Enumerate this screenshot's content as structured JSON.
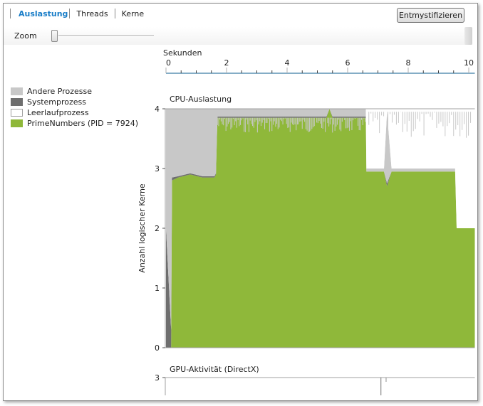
{
  "tabs": [
    {
      "label": "Auslastung",
      "active": true
    },
    {
      "label": "Threads",
      "active": false
    },
    {
      "label": "Kerne",
      "active": false
    }
  ],
  "toolbar": {
    "demystify_label": "Entmystifizieren",
    "zoom_label": "Zoom",
    "zoom_level": 0
  },
  "timeline": {
    "label": "Sekunden",
    "ticks": [
      "0",
      "2",
      "4",
      "6",
      "8",
      "10"
    ]
  },
  "legend": [
    {
      "label": "Andere Prozesse",
      "color": "#c8c8c8"
    },
    {
      "label": "Systemprozess",
      "color": "#6e6e6e"
    },
    {
      "label": "Leerlaufprozess",
      "color": "#ffffff"
    },
    {
      "label": "PrimeNumbers (PID = 7924)",
      "color": "#8fb83a"
    }
  ],
  "chart_data": [
    {
      "type": "area",
      "title": "CPU-Auslastung",
      "xlabel": "Sekunden",
      "ylabel": "Anzahl logischer Kerne",
      "xlim": [
        0,
        10.2
      ],
      "ylim": [
        0,
        4
      ],
      "yticks": [
        "0",
        "1",
        "2",
        "3",
        "4"
      ],
      "xticks": [
        0,
        2,
        4,
        6,
        8,
        10
      ],
      "x": [
        0,
        0.1,
        0.17,
        0.2,
        0.4,
        0.8,
        1.2,
        1.6,
        1.65,
        1.7,
        2.5,
        3.5,
        4.5,
        5.3,
        5.4,
        5.5,
        6.2,
        6.6,
        6.62,
        7.0,
        7.2,
        7.3,
        7.45,
        7.5,
        8.5,
        9.5,
        9.55,
        9.6,
        10.2
      ],
      "series": [
        {
          "name": "PrimeNumbers (PID = 7924)",
          "color": "#8fb83a",
          "values": [
            0,
            0,
            0,
            2.8,
            2.85,
            2.9,
            2.85,
            2.85,
            2.9,
            3.85,
            3.85,
            3.85,
            3.85,
            3.85,
            4.0,
            3.85,
            3.85,
            3.85,
            2.95,
            2.95,
            2.95,
            2.7,
            2.95,
            2.95,
            2.95,
            2.95,
            2.95,
            2.0,
            2.0
          ]
        },
        {
          "name": "Systemprozess",
          "color": "#6e6e6e",
          "values": [
            2.0,
            1.0,
            0.3,
            0.05,
            0.02,
            0.02,
            0.02,
            0.02,
            0.02,
            0.02,
            0.02,
            0.02,
            0.02,
            0.02,
            0,
            0.02,
            0.02,
            0.02,
            0,
            0,
            0,
            0.05,
            0,
            0,
            0,
            0,
            0,
            0,
            0
          ]
        },
        {
          "name": "Andere Prozesse",
          "color": "#c8c8c8",
          "values": [
            2.0,
            3.0,
            3.7,
            1.15,
            1.13,
            1.08,
            1.13,
            1.13,
            1.08,
            0.13,
            0.13,
            0.13,
            0.13,
            0.13,
            0,
            0.13,
            0.13,
            0.13,
            0.05,
            0.05,
            0.05,
            1.2,
            0.05,
            0.05,
            0.05,
            0.05,
            0.05,
            0,
            0
          ]
        },
        {
          "name": "Leerlaufprozess",
          "color": "#ffffff",
          "values": [
            0,
            0,
            0,
            0,
            0,
            0,
            0,
            0,
            0,
            0,
            0,
            0,
            0,
            0,
            0,
            0,
            0,
            0,
            1.0,
            1.0,
            1.0,
            0.05,
            1.0,
            1.0,
            1.0,
            1.0,
            1.0,
            2.0,
            2.0
          ]
        }
      ]
    },
    {
      "type": "line",
      "title": "GPU-Aktivität (DirectX)",
      "ylim": [
        0,
        3
      ],
      "yticks": [
        "3"
      ],
      "xlim": [
        0,
        10.2
      ],
      "series": []
    }
  ]
}
